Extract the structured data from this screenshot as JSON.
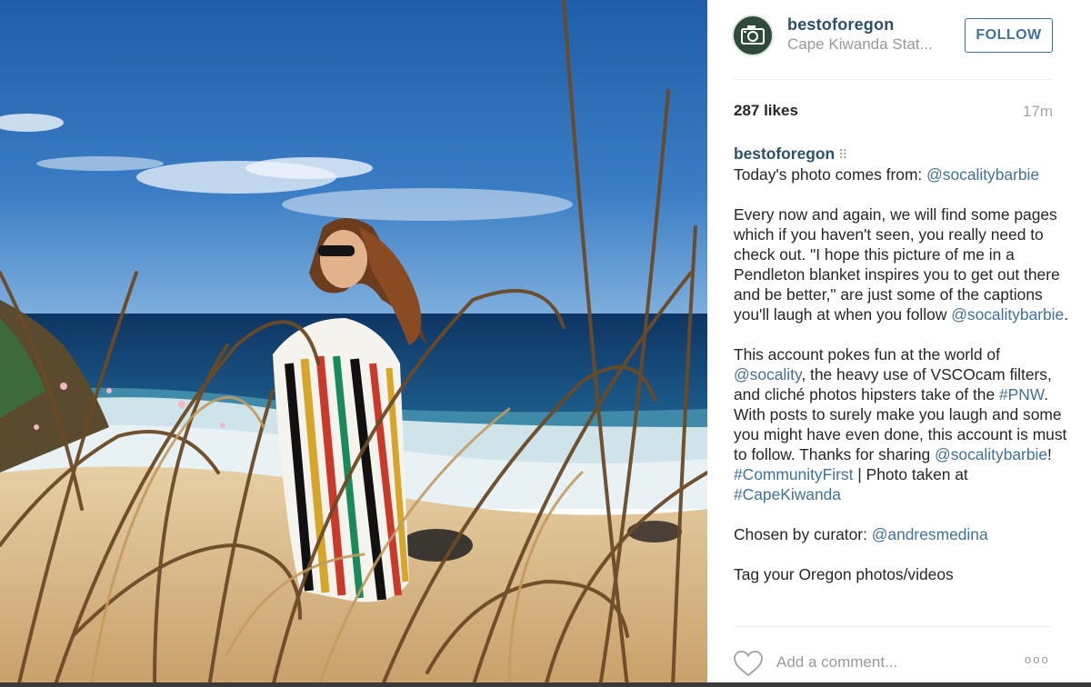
{
  "post": {
    "username": "bestoforegon",
    "location": "Cape Kiwanda Stat...",
    "follow_label": "FOLLOW",
    "likes": "287 likes",
    "time": "17m"
  },
  "caption": {
    "username": "bestoforegon",
    "line1_text": "Today's photo comes from: ",
    "line1_mention": "@socalitybarbie",
    "p2_text": "Every now and again, we will find some pages which if you haven't seen, you really need to check out. \"I hope this picture of me in a Pendleton blanket inspires you to get out there and be better,\" are just some of the captions you'll laugh at when you follow ",
    "p2_mention": "@socalitybarbie",
    "p2_end": ".",
    "p3_a": "This account pokes fun at the world of ",
    "p3_mention1": "@socality",
    "p3_b": ", the heavy use of VSCOcam filters, and cliché photos hipsters take of the ",
    "p3_tag1": "#PNW",
    "p3_c": ". With posts to surely make you laugh and some you might have even done, this account is must to follow. Thanks for sharing ",
    "p3_mention2": "@socalitybarbie",
    "p3_d": "!",
    "p3_tag2": "#CommunityFirst",
    "p3_e": " | Photo taken at ",
    "p3_tag3": "#CapeKiwanda",
    "p4_text": "Chosen by curator: ",
    "p4_mention": "@andresmedina",
    "p5_text": "Tag your Oregon photos/videos"
  },
  "comment": {
    "placeholder": "Add a comment...",
    "more_label": "ooo"
  },
  "icons": {
    "avatar": "camera-icon",
    "heart": "heart-icon",
    "options": "dots-icon"
  },
  "colors": {
    "link": "#3f729b",
    "username": "#2c4f6e",
    "sky": "#2f6fb5",
    "ocean": "#123d6e",
    "sand": "#d9b98a"
  }
}
